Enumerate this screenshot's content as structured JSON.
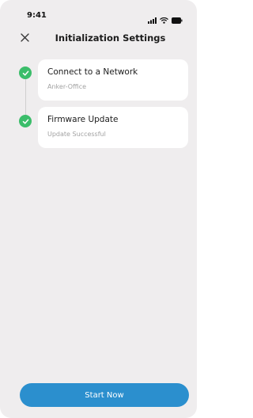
{
  "status_bar": {
    "time": "9:41",
    "icons": [
      "signal-icon",
      "wifi-icon",
      "battery-icon"
    ]
  },
  "header": {
    "title": "Initialization Settings",
    "close_icon": "close-icon"
  },
  "steps": [
    {
      "title": "Connect to a Network",
      "subtitle": "Anker-Office",
      "status": "complete",
      "icon": "check-icon"
    },
    {
      "title": "Firmware Update",
      "subtitle": "Update Successful",
      "status": "complete",
      "icon": "check-icon"
    }
  ],
  "footer": {
    "start_label": "Start Now"
  },
  "colors": {
    "background": "#efedee",
    "card": "#ffffff",
    "success": "#3bbd6a",
    "primary": "#2b8fce",
    "subtitle": "#a2a2a2"
  }
}
